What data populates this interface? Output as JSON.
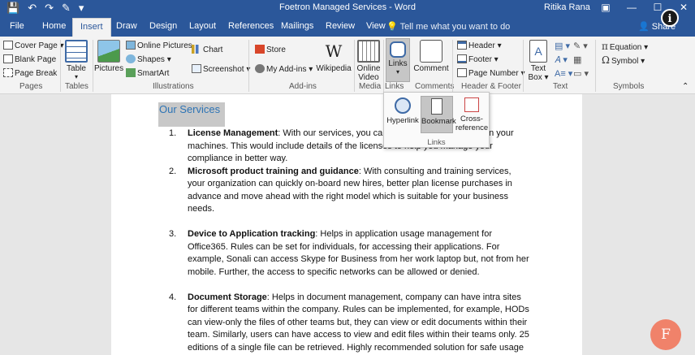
{
  "titlebar": {
    "title": "Foetron Managed Services  -  Word",
    "user": "Ritika Rana",
    "qat": [
      "💾",
      "↶",
      "↷",
      "✎",
      "▾"
    ],
    "controls": [
      "▣",
      "—",
      "☐",
      "✕"
    ]
  },
  "tabs": [
    "File",
    "Home",
    "Insert",
    "Draw",
    "Design",
    "Layout",
    "References",
    "Mailings",
    "Review",
    "View"
  ],
  "tell_me": "Tell me what you want to do",
  "share": "Share",
  "ribbon": {
    "pages": {
      "items": [
        "Cover Page ▾",
        "Blank Page",
        "Page Break"
      ],
      "label": "Pages"
    },
    "tables": {
      "button": "Table",
      "label": "Tables"
    },
    "illustrations": {
      "pictures": "Pictures",
      "items": [
        "Online Pictures",
        "Shapes ▾",
        "SmartArt",
        "Chart",
        "Screenshot ▾"
      ],
      "label": "Illustrations"
    },
    "addins": {
      "items": [
        "Store",
        "My Add-ins ▾"
      ],
      "wikipedia": "Wikipedia",
      "label": "Add-ins"
    },
    "media": {
      "button1": "Online",
      "button2": "Video",
      "label": "Media"
    },
    "links": {
      "button": "Links",
      "label": "Links"
    },
    "comments": {
      "button": "Comment",
      "label": "Comments"
    },
    "header_footer": {
      "items": [
        "Header ▾",
        "Footer ▾",
        "Page Number ▾"
      ],
      "label": "Header & Footer"
    },
    "text": {
      "button1": "Text",
      "button2": "Box ▾",
      "label": "Text"
    },
    "symbols": {
      "items": [
        "Equation ▾",
        "Symbol ▾"
      ],
      "label": "Symbols"
    }
  },
  "links_dropdown": {
    "hyperlink": "Hyperlink",
    "bookmark": "Bookmark",
    "cross1": "Cross-",
    "cross2": "reference",
    "label": "Links"
  },
  "document": {
    "heading": "Our Services",
    "items": [
      {
        "num": "1.",
        "title": "License Management",
        "text": ": With our services, you can track the license usage on your machines. This would include details of the licenses to help you manage your compliance in better way."
      },
      {
        "num": "2.",
        "title": "Microsoft product training and guidance",
        "text": ": With consulting and training services, your organization can quickly on-board new hires, better plan license purchases in advance and move ahead with the right model which is suitable for your business needs."
      },
      {
        "num": "3.",
        "title": "Device to Application tracking",
        "text": ": Helps in application usage management for Office365. Rules can be set for individuals, for accessing their applications. For example, Sonali can access Skype for Business from her work laptop but, not from her mobile. Further, the access to specific networks can be allowed or denied."
      },
      {
        "num": "4.",
        "title": "Document Storage",
        "text": ": Helps in document management, company can have intra sites for different teams within the company. Rules can be implemented, for example, HODs can view-only the files of other teams but, they can view or edit documents within their team. Similarly, users can have access to view and edit files within their teams only. 25 editions of a single file can be retrieved. Highly recommended solution for safe usage of important files."
      }
    ]
  },
  "overlay": {
    "info": "i",
    "avatar": "F"
  },
  "colors": {
    "brand": "#2b579a",
    "heading": "#2e74b5",
    "avatar": "#f0826a"
  }
}
